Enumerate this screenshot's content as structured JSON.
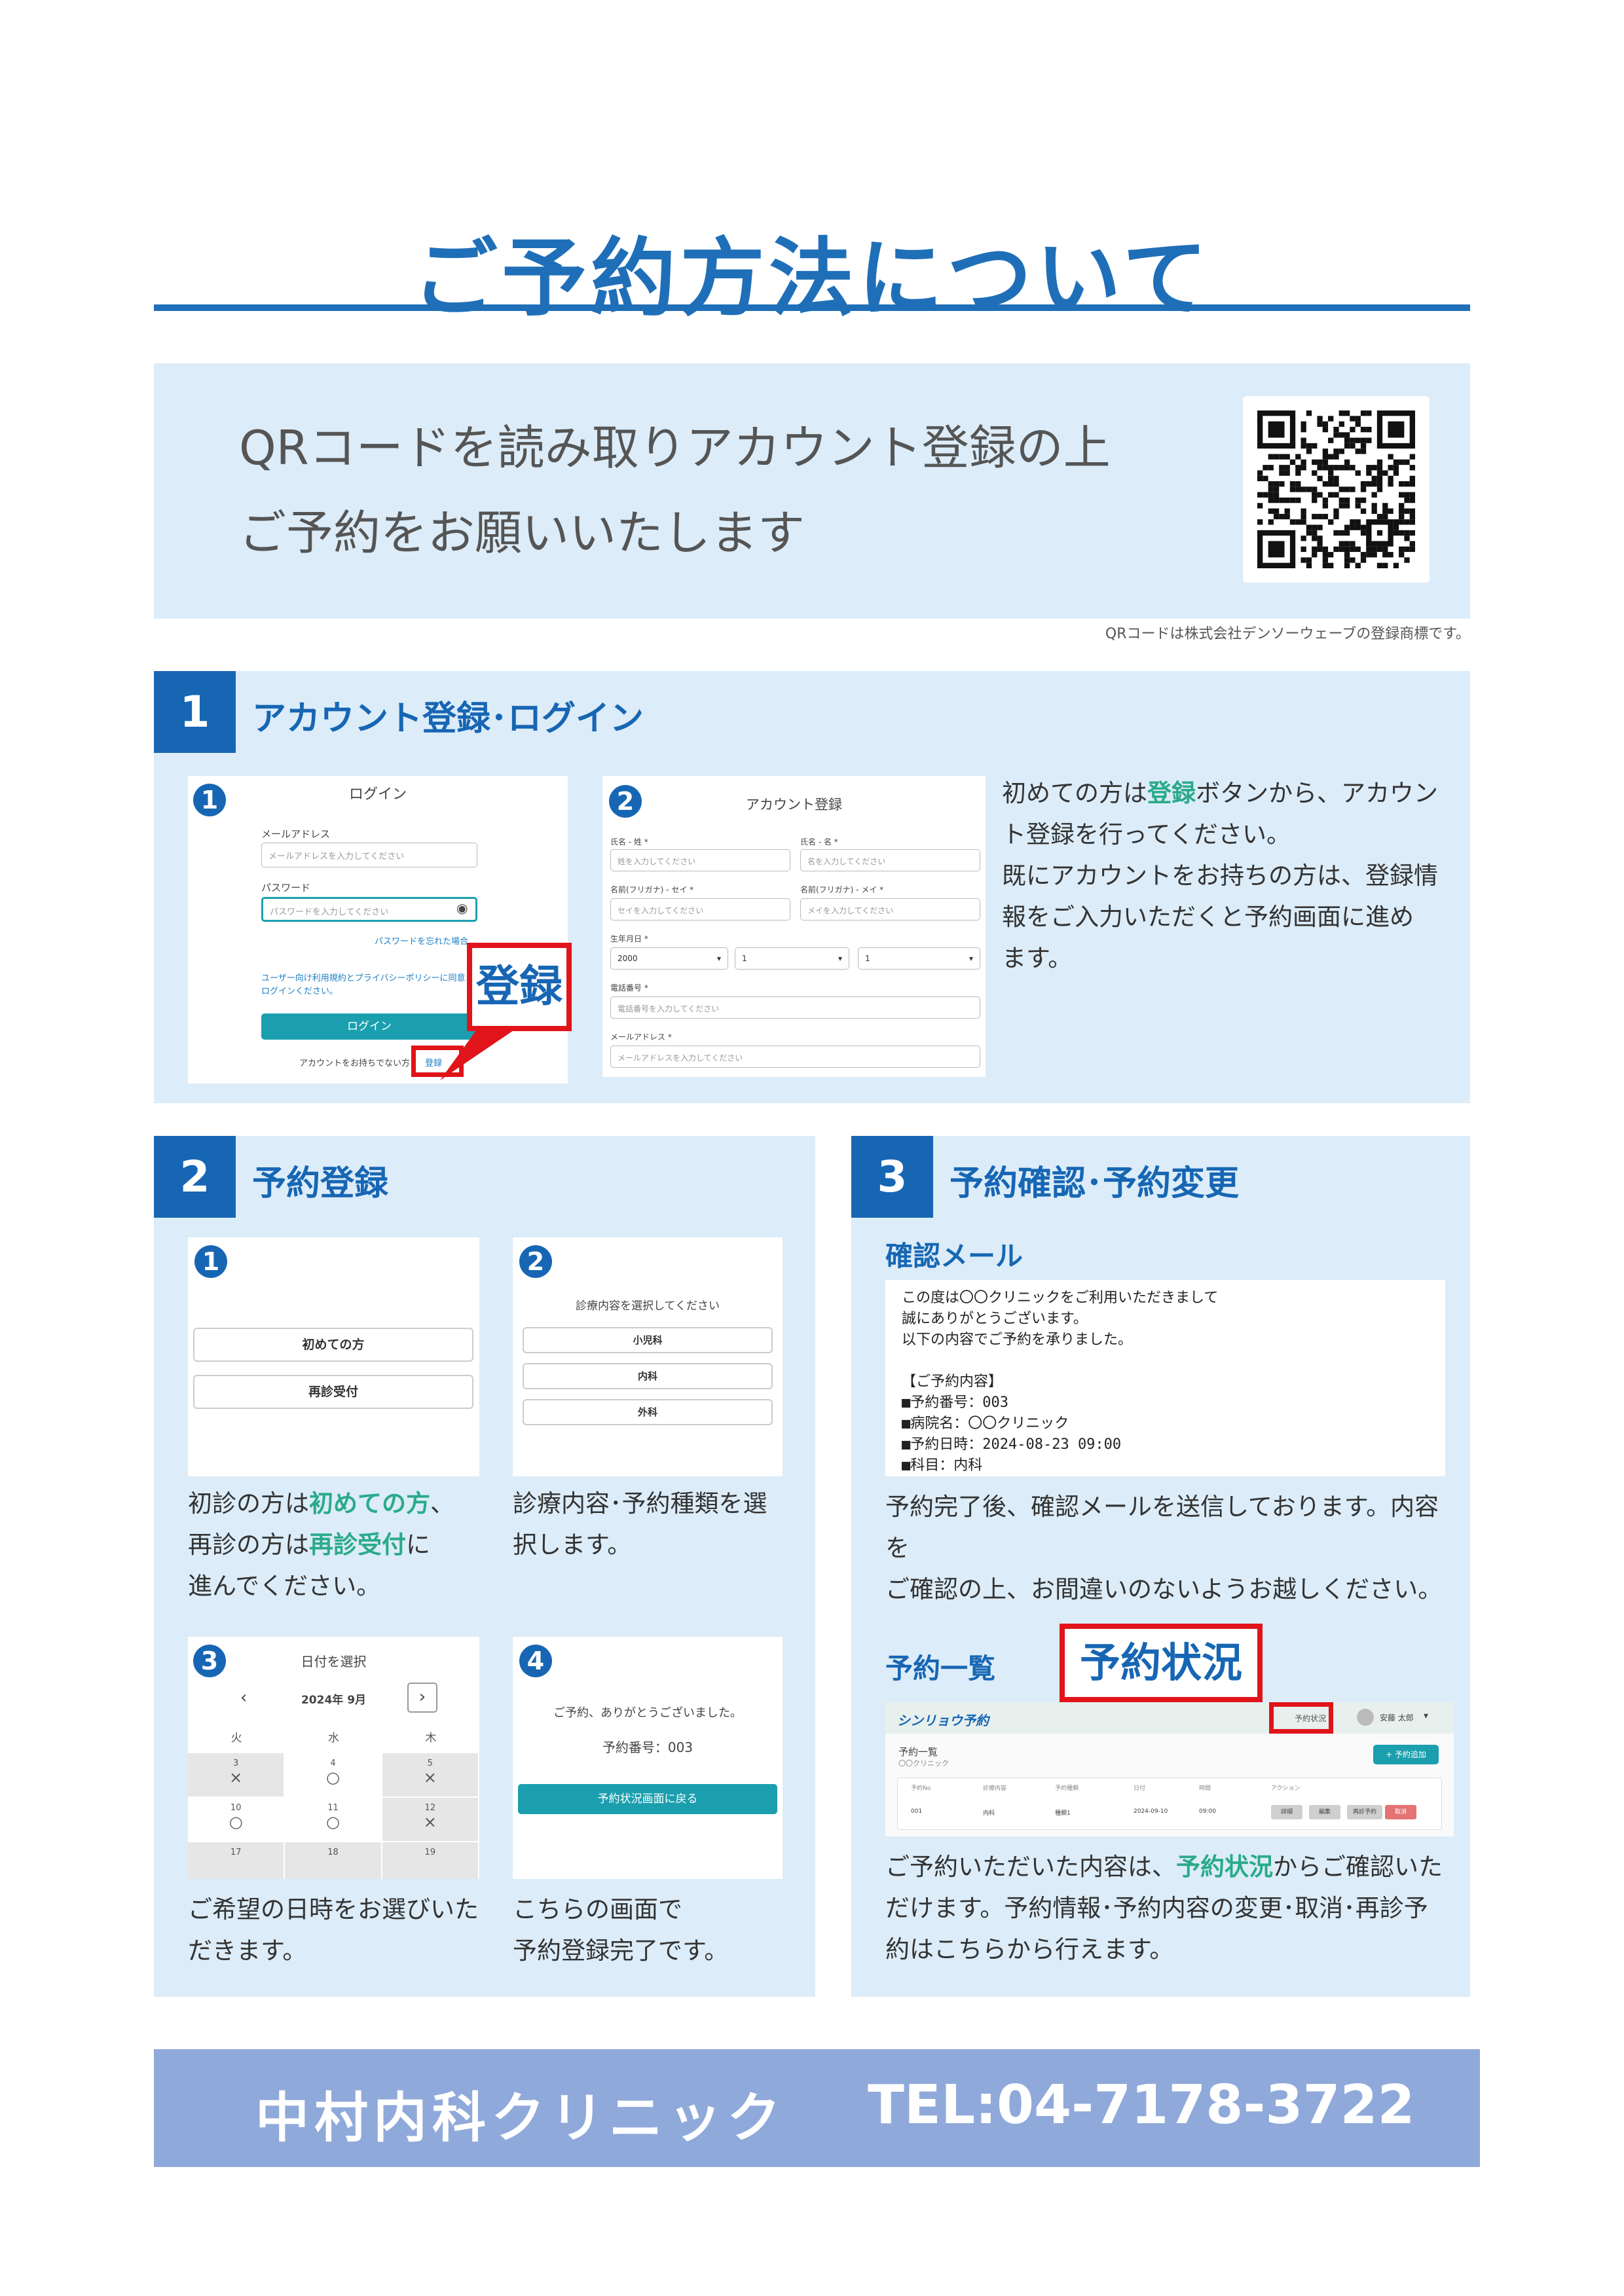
{
  "title": "ご予約方法について",
  "qr_section": {
    "line1": "QRコードを読み取りアカウント登録の上",
    "line2": "ご予約をお願いいたします",
    "note": "QRコードは株式会社デンソーウェーブの登録商標です。"
  },
  "section1": {
    "number": "1",
    "title": "アカウント登録･ログイン",
    "shot1": {
      "marker": "1",
      "heading": "ログイン",
      "email_label": "メールアドレス",
      "email_placeholder": "メールアドレスを入力してください",
      "password_label": "パスワード",
      "password_placeholder": "パスワードを入力してください",
      "forgot": "パスワードを忘れた場合",
      "terms": "ユーザー向け利用規約とプライバシーポリシーに同意してログインください。",
      "login_button": "ログイン",
      "no_account": "アカウントをお持ちでない方",
      "register_link": "登録"
    },
    "shot2": {
      "marker": "2",
      "heading": "アカウント登録",
      "last_name_label": "氏名 - 姓 *",
      "last_name_placeholder": "姓を入力してください",
      "first_name_label": "氏名 - 名 *",
      "first_name_placeholder": "名を入力してください",
      "kana_last_label": "名前(フリガナ) - セイ *",
      "kana_last_placeholder": "セイを入力してください",
      "kana_first_label": "名前(フリガナ) - メイ *",
      "kana_first_placeholder": "メイを入力してください",
      "birth_label": "生年月日 *",
      "birth_year": "2000",
      "birth_month": "1",
      "birth_day": "1",
      "phone_label": "電話番号 *",
      "phone_placeholder": "電話番号を入力してください",
      "mail_label": "メールアドレス *",
      "mail_placeholder": "メールアドレスを入力してください"
    },
    "callout": "登録",
    "text_l1_a": "初めての方は",
    "text_l1_b": "登録",
    "text_l1_c": "ボタンから、アカウン",
    "text_l2": "ト登録を行ってください。",
    "text_l3": "既にアカウントをお持ちの方は、登録情",
    "text_l4": "報をご入力いただくと予約画面に進め",
    "text_l5": "ます。"
  },
  "section2": {
    "number": "2",
    "title": "予約登録",
    "step1": {
      "marker": "1",
      "btn_first": "初めての方",
      "btn_return": "再診受付"
    },
    "step1_text": {
      "a": "初診の方は",
      "b": "初めての方",
      "c": "、",
      "d": "再診の方は",
      "e": "再診受付",
      "f": "に",
      "g": "進んでください。"
    },
    "step2": {
      "marker": "2",
      "heading": "診療内容を選択してください",
      "opt1": "小児科",
      "opt2": "内科",
      "opt3": "外科"
    },
    "step2_text": {
      "l1": "診療内容･予約種類を選",
      "l2": "択します。"
    },
    "step3": {
      "marker": "3",
      "heading": "日付を選択",
      "prev": "‹",
      "month": "2024年 9月",
      "next": "›",
      "weekdays": [
        "火",
        "水",
        "木"
      ],
      "rows": [
        [
          {
            "d": "3",
            "s": "×"
          },
          {
            "d": "4",
            "s": "○"
          },
          {
            "d": "5",
            "s": "×"
          }
        ],
        [
          {
            "d": "10",
            "s": "○"
          },
          {
            "d": "11",
            "s": "○"
          },
          {
            "d": "12",
            "s": "×"
          }
        ],
        [
          {
            "d": "17",
            "s": ""
          },
          {
            "d": "18",
            "s": ""
          },
          {
            "d": "19",
            "s": ""
          }
        ]
      ]
    },
    "step3_text": {
      "l1": "ご希望の日時をお選びいた",
      "l2": "だきます。"
    },
    "step4": {
      "marker": "4",
      "thanks": "ご予約、ありがとうございました。",
      "number_line": "予約番号：003",
      "back_button": "予約状況画面に戻る"
    },
    "step4_text": {
      "l1": "こちらの画面で",
      "l2": "予約登録完了です。"
    }
  },
  "section3": {
    "number": "3",
    "title": "予約確認･予約変更",
    "mail_heading": "確認メール",
    "mail_lines": [
      "この度は〇〇クリニックをご利用いただきまして",
      "誠にありがとうございます。",
      "以下の内容でご予約を承りました。",
      "",
      "【ご予約内容】",
      "■予約番号：003",
      "■病院名：〇〇クリニック",
      "■予約日時：2024-08-23 09:00",
      "■科目：内科"
    ],
    "mail_text": {
      "l1": "予約完了後、確認メールを送信しております。内容を",
      "l2": "ご確認の上、お間違いのないようお越しください。"
    },
    "list_heading": "予約一覧",
    "callout": "予約状況",
    "app": {
      "logo": "シンリョウ予約",
      "nav_status": "予約状況",
      "user": "安藤 太郎",
      "list_title": "予約一覧",
      "clinic": "〇〇クリニック",
      "add_button": "+ 予約追加",
      "columns": [
        "予約No",
        "診療内容",
        "予約種類",
        "日付",
        "時間",
        "アクション"
      ],
      "row": [
        "001",
        "内科",
        "種類1",
        "2024-09-10",
        "09:00"
      ],
      "actions": [
        "詳細",
        "編集",
        "再診予約",
        "取消"
      ]
    },
    "list_text": {
      "a": "ご予約いただいた内容は、",
      "b": "予約状況",
      "c": "からご確認いた",
      "l2": "だけます。予約情報･予約内容の変更･取消･再診予",
      "l3": "約はこちらから行えます。"
    }
  },
  "footer": {
    "clinic": "中村内科クリニック",
    "tel": "TEL:04-7178-3722"
  }
}
